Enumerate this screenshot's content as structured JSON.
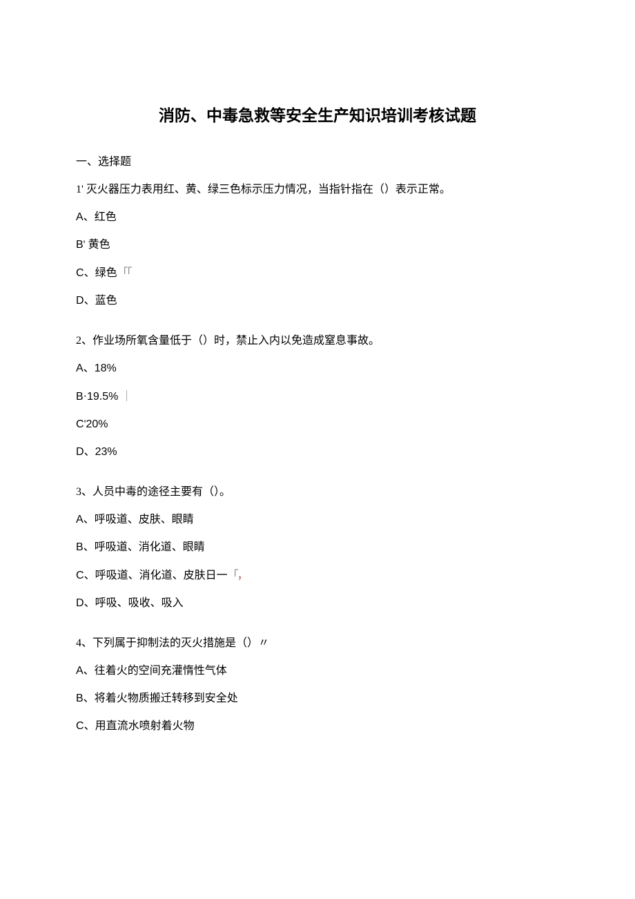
{
  "title": "消防、中毒急救等安全生产知识培训考核试题",
  "section_heading": "一、选择题",
  "questions": [
    {
      "text": "1' 灭火器压力表用红、黄、绿三色标示压力情况，当指针指在（）表示正常。",
      "options": [
        {
          "prefix": "A",
          "sep": "、",
          "text": "红色",
          "mark": ""
        },
        {
          "prefix": "B",
          "sep": "' ",
          "text": "黄色",
          "mark": ""
        },
        {
          "prefix": "C",
          "sep": "、",
          "text": "绿色",
          "mark": "「「"
        },
        {
          "prefix": "D",
          "sep": "、",
          "text": "蓝色",
          "mark": ""
        }
      ]
    },
    {
      "text": "2、作业场所氧含量低于（）时，禁止入内以免造成窒息事故。",
      "options": [
        {
          "prefix": "A",
          "sep": "、",
          "text": "18%",
          "mark": ""
        },
        {
          "prefix": "B",
          "sep": "·",
          "text": "19.5%",
          "mark": "｜"
        },
        {
          "prefix": "C",
          "sep": "'",
          "text": "20%",
          "mark": ""
        },
        {
          "prefix": "D",
          "sep": "、",
          "text": "23%",
          "mark": ""
        }
      ]
    },
    {
      "text": "3、人员中毒的途径主要有（）。",
      "options": [
        {
          "prefix": "A",
          "sep": "、",
          "text": "呼吸道、皮肤、眼睛",
          "mark": ""
        },
        {
          "prefix": "B",
          "sep": "、",
          "text": "呼吸道、消化道、眼睛",
          "mark": ""
        },
        {
          "prefix": "C",
          "sep": "、",
          "text": "呼吸道、消化道、皮肤日一",
          "mark": "「，"
        },
        {
          "prefix": "D",
          "sep": "、",
          "text": "呼吸、吸收、吸入",
          "mark": ""
        }
      ]
    },
    {
      "text": "4、下列属于抑制法的灭火措施是（）〃",
      "options": [
        {
          "prefix": "A",
          "sep": "、",
          "text": "往着火的空间充灌惰性气体",
          "mark": ""
        },
        {
          "prefix": "B",
          "sep": "、",
          "text": "将着火物质搬迁转移到安全处",
          "mark": ""
        },
        {
          "prefix": "C",
          "sep": "、",
          "text": "用直流水喷射着火物",
          "mark": ""
        }
      ]
    }
  ]
}
